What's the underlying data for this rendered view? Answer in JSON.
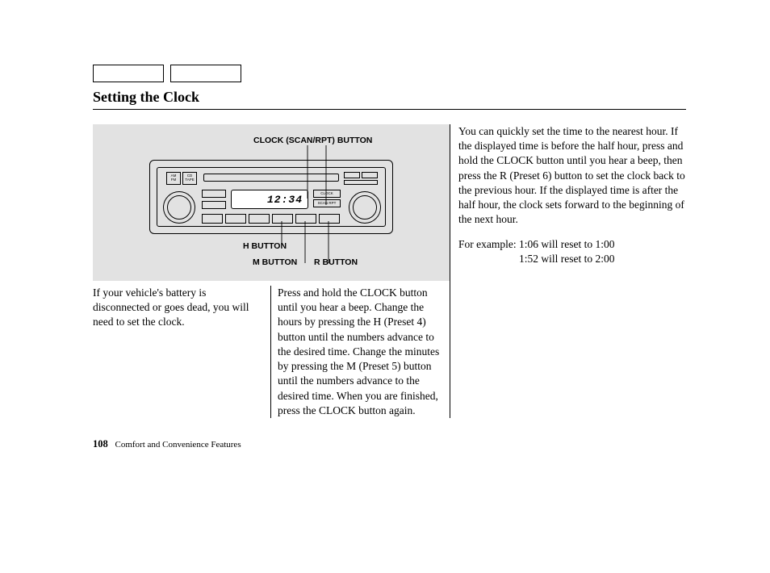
{
  "title": "Setting the Clock",
  "figure": {
    "callout_top": "CLOCK (SCAN/RPT) BUTTON",
    "callout_h": "H BUTTON",
    "callout_m": "M BUTTON",
    "callout_r": "R BUTTON",
    "display_time": "12:34",
    "cd_label": "CD",
    "btn_am_fm": "AM\nFM",
    "btn_cd_tape": "CD\nTAPE",
    "btn_right_top": "CLOCK",
    "btn_right_bot": "SCAN RPT"
  },
  "col1_text": "If your vehicle's battery is disconnected or goes dead, you will need to set the clock.",
  "col2_text": "Press and hold the CLOCK button until you hear a beep. Change the hours by pressing the H (Preset 4) button until the numbers advance to the desired time. Change the minutes by pressing the M (Preset 5) button until the numbers advance to the desired time. When you are finished, press the CLOCK button again.",
  "col3_text": "You can quickly set the time to the nearest hour. If the displayed time is before the half hour, press and hold the CLOCK button until you hear a beep, then press the R (Preset 6) button to set the clock back to the previous hour. If the displayed time is after the half hour, the clock sets forward to the beginning of the next hour.",
  "example_label": "For example:",
  "example_line1": "1:06 will reset to 1:00",
  "example_line2": "1:52 will reset to 2:00",
  "footer_page": "108",
  "footer_section": "Comfort and Convenience Features"
}
